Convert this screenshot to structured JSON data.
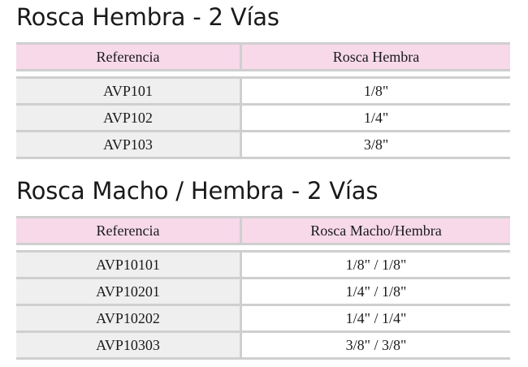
{
  "sections": [
    {
      "title": "Rosca Hembra - 2 Vías",
      "columns": [
        "Referencia",
        "Rosca Hembra"
      ],
      "rows": [
        [
          "AVP101",
          "1/8\""
        ],
        [
          "AVP102",
          "1/4\""
        ],
        [
          "AVP103",
          "3/8\""
        ]
      ]
    },
    {
      "title": "Rosca Macho / Hembra - 2 Vías",
      "columns": [
        "Referencia",
        "Rosca Macho/Hembra"
      ],
      "rows": [
        [
          "AVP10101",
          "1/8\" / 1/8\""
        ],
        [
          "AVP10201",
          "1/4\" / 1/8\""
        ],
        [
          "AVP10202",
          "1/4\" / 1/4\""
        ],
        [
          "AVP10303",
          "3/8\" / 3/8\""
        ]
      ]
    }
  ]
}
